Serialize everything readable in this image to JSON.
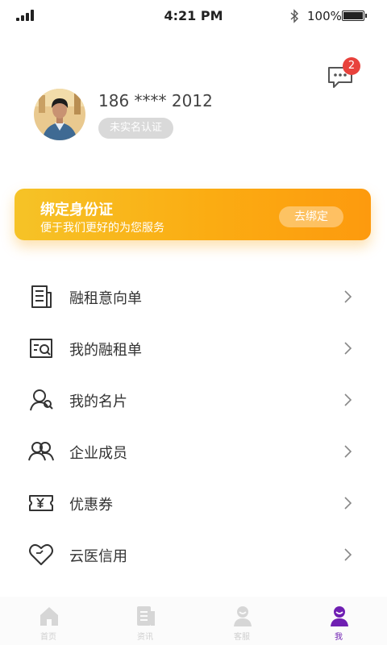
{
  "status_bar": {
    "time": "4:21 PM",
    "battery": "100%"
  },
  "header": {
    "message_count": "2"
  },
  "profile": {
    "phone": "186 **** 2012",
    "verify_label": "未实名认证"
  },
  "banner": {
    "title": "绑定身份证",
    "subtitle": "便于我们更好的为您服务",
    "button_label": "去绑定"
  },
  "menu": [
    {
      "label": "融租意向单",
      "icon": "document-icon"
    },
    {
      "label": "我的融租单",
      "icon": "search-document-icon"
    },
    {
      "label": "我的名片",
      "icon": "person-card-icon"
    },
    {
      "label": "企业成员",
      "icon": "group-icon"
    },
    {
      "label": "优惠券",
      "icon": "coupon-icon"
    },
    {
      "label": "云医信用",
      "icon": "heart-icon"
    }
  ],
  "tabs": [
    {
      "label": "首页",
      "icon": "home-icon",
      "active": false
    },
    {
      "label": "资讯",
      "icon": "news-icon",
      "active": false
    },
    {
      "label": "客服",
      "icon": "service-icon",
      "active": false
    },
    {
      "label": "我",
      "icon": "me-icon",
      "active": true
    }
  ],
  "colors": {
    "accent": "#6f1fb2",
    "badge": "#e8423c",
    "banner_start": "#f6c327",
    "banner_end": "#fd9a0e"
  }
}
